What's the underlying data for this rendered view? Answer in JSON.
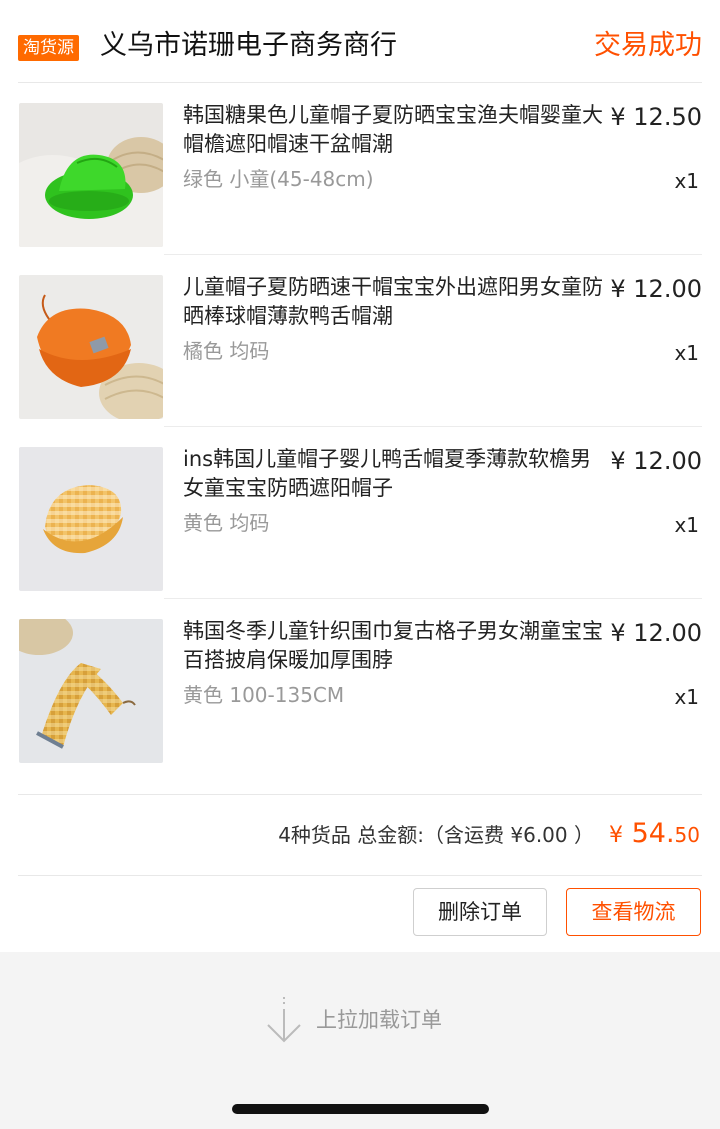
{
  "shop": {
    "badge": "淘货源",
    "name": "义乌市诺珊电子商务商行",
    "status": "交易成功"
  },
  "items": [
    {
      "title": "韩国糖果色儿童帽子夏防晒宝宝渔夫帽婴童大帽檐遮阳帽速干盆帽潮",
      "spec": "绿色 小童(45-48cm)",
      "price": "¥ 12.50",
      "qty": "x1",
      "thumb": "green-bucket-hat"
    },
    {
      "title": "儿童帽子夏防晒速干帽宝宝外出遮阳男女童防晒棒球帽薄款鸭舌帽潮",
      "spec": "橘色 均码",
      "price": "¥ 12.00",
      "qty": "x1",
      "thumb": "orange-baseball-cap"
    },
    {
      "title": "ins韩国儿童帽子婴儿鸭舌帽夏季薄款软檐男女童宝宝防晒遮阳帽子",
      "spec": "黄色 均码",
      "price": "¥ 12.00",
      "qty": "x1",
      "thumb": "yellow-plaid-cap"
    },
    {
      "title": "韩国冬季儿童针织围巾复古格子男女潮童宝宝百搭披肩保暖加厚围脖",
      "spec": "黄色 100-135CM",
      "price": "¥ 12.00",
      "qty": "x1",
      "thumb": "yellow-plaid-scarf"
    }
  ],
  "summary": {
    "text": "4种货品 总金额:（含运费 ¥6.00 ）",
    "total_symbol": "¥",
    "total_int": " 54.",
    "total_dec": "50"
  },
  "actions": {
    "delete": "删除订单",
    "logistics": "查看物流"
  },
  "footer": {
    "load_more": "上拉加载订单"
  },
  "colors": {
    "accent": "#ff5000",
    "badge": "#ff6a00"
  }
}
